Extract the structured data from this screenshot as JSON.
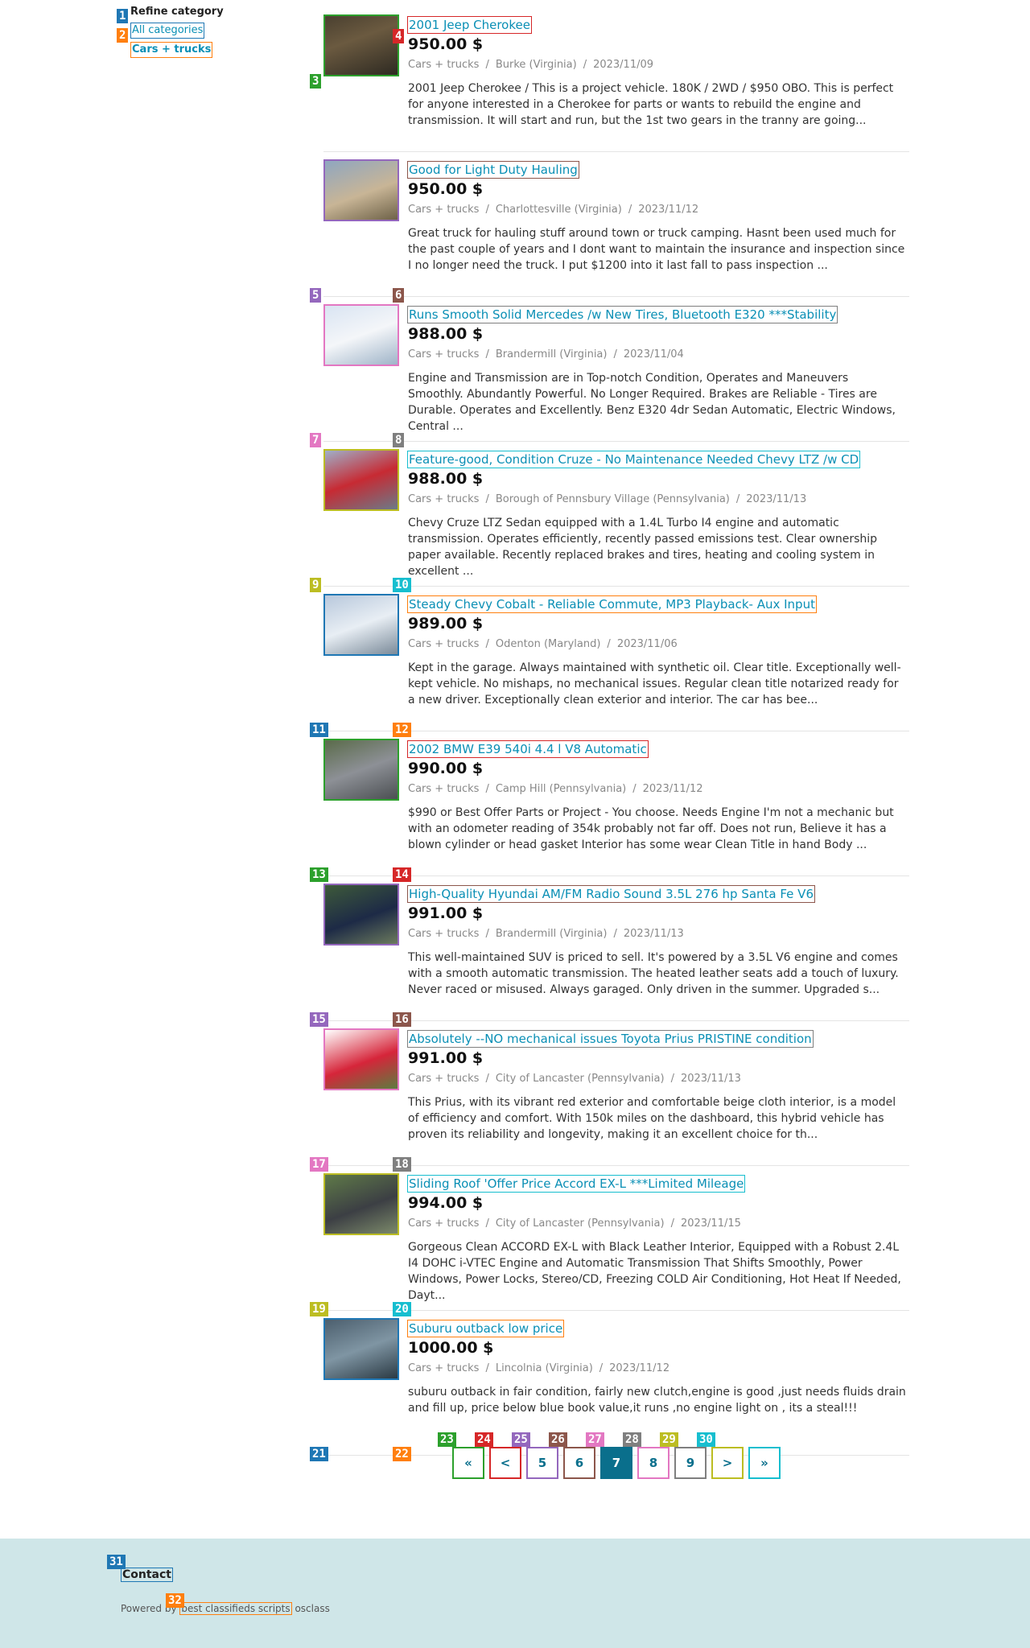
{
  "sidebar": {
    "heading": "Refine category",
    "links": [
      "All categories",
      "Cars + trucks"
    ]
  },
  "listings": [
    {
      "title": "2001 Jeep Cherokee",
      "price": "950.00 $",
      "category": "Cars + trucks",
      "location": "Burke (Virginia)",
      "date": "2023/11/09",
      "desc": "2001 Jeep Cherokee / This is a project vehicle. 180K / 2WD / $950 OBO. This is perfect for anyone interested in a Cherokee for parts or wants to rebuild the engine and transmission. It will start and run, but the 1st two gears in the tranny are going..."
    },
    {
      "title": "Good for Light Duty Hauling",
      "price": "950.00 $",
      "category": "Cars + trucks",
      "location": "Charlottesville (Virginia)",
      "date": "2023/11/12",
      "desc": "Great truck for hauling stuff around town or truck camping. Hasnt been used much for the past couple of years and I dont want to maintain the insurance and inspection since I no longer need the truck. I put $1200 into it last fall to pass inspection ..."
    },
    {
      "title": "Runs Smooth Solid Mercedes /w New Tires, Bluetooth E320 ***Stability",
      "price": "988.00 $",
      "category": "Cars + trucks",
      "location": "Brandermill (Virginia)",
      "date": "2023/11/04",
      "desc": "Engine and Transmission are in Top-notch Condition, Operates and Maneuvers Smoothly. Abundantly Powerful. No Longer Required. Brakes are Reliable - Tires are Durable. Operates and Excellently. Benz E320 4dr Sedan Automatic, Electric Windows, Central ..."
    },
    {
      "title": "Feature-good, Condition Cruze - No Maintenance Needed Chevy LTZ /w CD",
      "price": "988.00 $",
      "category": "Cars + trucks",
      "location": "Borough of Pennsbury Village (Pennsylvania)",
      "date": "2023/11/13",
      "desc": "Chevy Cruze LTZ Sedan equipped with a 1.4L Turbo I4 engine and automatic transmission. Operates efficiently, recently passed emissions test. Clear ownership paper available. Recently replaced brakes and tires, heating and cooling system in excellent ..."
    },
    {
      "title": "Steady Chevy Cobalt - Reliable Commute, MP3 Playback- Aux Input",
      "price": "989.00 $",
      "category": "Cars + trucks",
      "location": "Odenton (Maryland)",
      "date": "2023/11/06",
      "desc": "Kept in the garage. Always maintained with synthetic oil. Clear title. Exceptionally well-kept vehicle. No mishaps, no mechanical issues. Regular clean title notarized ready for a new driver. Exceptionally clean exterior and interior. The car has bee..."
    },
    {
      "title": "2002 BMW E39 540i 4.4 l V8 Automatic",
      "price": "990.00 $",
      "category": "Cars + trucks",
      "location": "Camp Hill (Pennsylvania)",
      "date": "2023/11/12",
      "desc": "$990 or Best Offer Parts or Project - You choose. Needs Engine I'm not a mechanic but with an odometer reading of 354k probably not far off. Does not run, Believe it has a blown cylinder or head gasket Interior has some wear Clean Title in hand Body ..."
    },
    {
      "title": "High-Quality Hyundai AM/FM Radio Sound 3.5L 276 hp Santa Fe V6",
      "price": "991.00 $",
      "category": "Cars + trucks",
      "location": "Brandermill (Virginia)",
      "date": "2023/11/13",
      "desc": "This well-maintained SUV is priced to sell. It's powered by a 3.5L V6 engine and comes with a smooth automatic transmission. The heated leather seats add a touch of luxury. Never raced or misused. Always garaged. Only driven in the summer. Upgraded s..."
    },
    {
      "title": "Absolutely --NO mechanical issues Toyota Prius PRISTINE condition",
      "price": "991.00 $",
      "category": "Cars + trucks",
      "location": "City of Lancaster (Pennsylvania)",
      "date": "2023/11/13",
      "desc": "This Prius, with its vibrant red exterior and comfortable beige cloth interior, is a model of efficiency and comfort. With 150k miles on the dashboard, this hybrid vehicle has proven its reliability and longevity, making it an excellent choice for th..."
    },
    {
      "title": "Sliding Roof 'Offer Price Accord EX-L ***Limited Mileage",
      "price": "994.00 $",
      "category": "Cars + trucks",
      "location": "City of Lancaster (Pennsylvania)",
      "date": "2023/11/15",
      "desc": "Gorgeous Clean ACCORD EX-L with Black Leather Interior, Equipped with a Robust 2.4L I4 DOHC i-VTEC Engine and Automatic Transmission That Shifts Smoothly, Power Windows, Power Locks, Stereo/CD, Freezing COLD Air Conditioning, Hot Heat If Needed, Dayt..."
    },
    {
      "title": "Suburu outback low price",
      "price": "1000.00 $",
      "category": "Cars + trucks",
      "location": "Lincolnia (Virginia)",
      "date": "2023/11/12",
      "desc": "suburu outback in fair condition, fairly new clutch,engine is good ,just needs fluids drain and fill up, price below blue book value,it runs ,no engine light on , its a steal!!!"
    }
  ],
  "pagination": [
    "«",
    "<",
    "5",
    "6",
    "7",
    "8",
    "9",
    ">",
    "»"
  ],
  "pagination_active": "7",
  "footer": {
    "contact": "Contact",
    "powered_prefix": "Powered by",
    "powered_link": "best classifieds scripts",
    "powered_suffix": "osclass"
  },
  "som_labels": [
    "1",
    "2",
    "3",
    "4",
    "5",
    "6",
    "7",
    "8",
    "9",
    "10",
    "11",
    "12",
    "13",
    "14",
    "15",
    "16",
    "17",
    "18",
    "19",
    "20",
    "21",
    "22",
    "23",
    "24",
    "25",
    "26",
    "27",
    "28",
    "29",
    "30",
    "31",
    "32"
  ],
  "som_colors": [
    "#1f77b4",
    "#ff7f0e",
    "#2ca02c",
    "#d62728",
    "#9467bd",
    "#8c564b",
    "#e377c2",
    "#7f7f7f",
    "#bcbd22",
    "#17becf"
  ],
  "thumb_styles": [
    "linear-gradient(160deg,#4a4030 0%,#6b5a40 40%,#2e2a22 100%)",
    "linear-gradient(160deg,#8fa6c0 0%,#c8b596 55%,#6e6248 100%)",
    "linear-gradient(160deg,#d9e4f2 0%,#f4f6f9 50%,#9fb4c8 100%)",
    "linear-gradient(160deg,#9fb0c9 0%,#c72a33 50%,#6b7a88 100%)",
    "linear-gradient(160deg,#b8c8dc 0%,#e8eef4 50%,#7a8a99 100%)",
    "linear-gradient(160deg,#5a6b4a 0%,#8d9096 50%,#4b4f52 100%)",
    "linear-gradient(160deg,#3e5a3a 0%,#1d2a46 55%,#6b7a5d 100%)",
    "linear-gradient(160deg,#ffffff 0%,#d6253a 55%,#5d7c3f 100%)",
    "linear-gradient(160deg,#5f7a48 0%,#3c3f44 55%,#7c8a6a 100%)",
    "linear-gradient(160deg,#4c5f6e 0%,#7f95a3 50%,#2b3a44 100%)"
  ]
}
